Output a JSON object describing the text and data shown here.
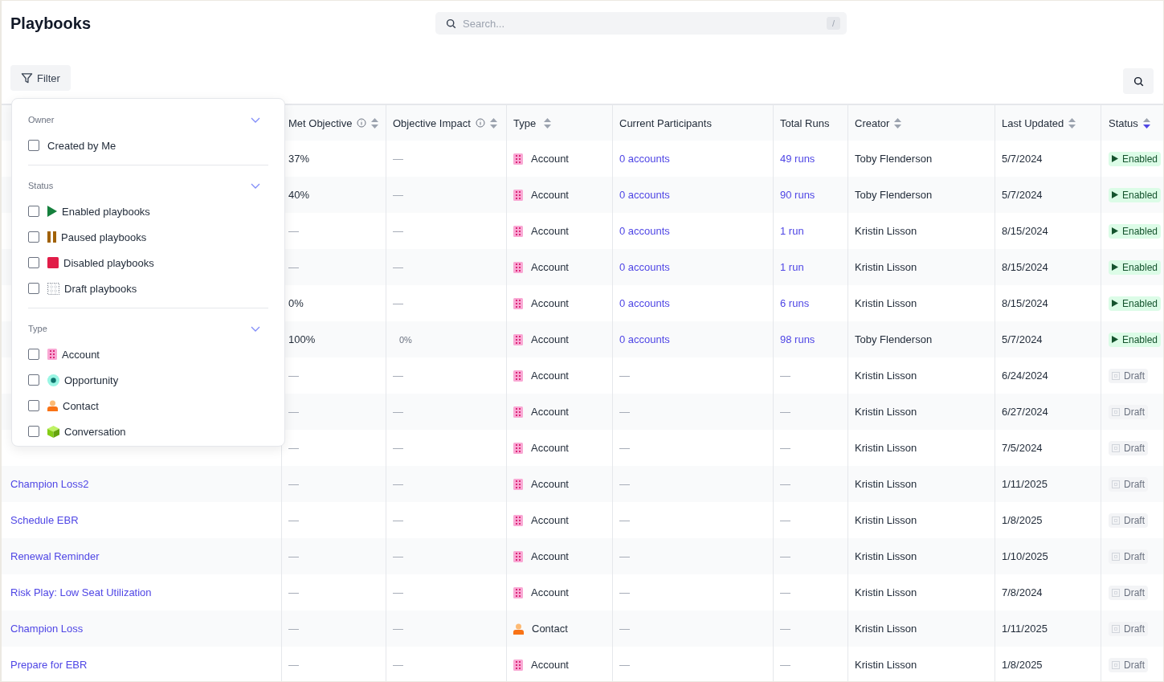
{
  "title": "Playbooks",
  "search": {
    "placeholder": "Search...",
    "shortcut": "/"
  },
  "filter_button": {
    "label": "Filter"
  },
  "table": {
    "columns": [
      {
        "label": "Met Objective",
        "info": true,
        "sortable": true,
        "sorted_desc": false
      },
      {
        "label": "Objective Impact",
        "info": true,
        "sortable": true,
        "sorted_desc": false
      },
      {
        "label": "Type",
        "info": false,
        "sortable": true,
        "sorted_desc": false
      },
      {
        "label": "Current Participants",
        "info": false,
        "sortable": false
      },
      {
        "label": "Total Runs",
        "info": false,
        "sortable": false
      },
      {
        "label": "Creator",
        "info": false,
        "sortable": true,
        "sorted_desc": false
      },
      {
        "label": "Last Updated",
        "info": false,
        "sortable": true,
        "sorted_desc": false
      },
      {
        "label": "Status",
        "info": false,
        "sortable": true,
        "sorted_desc": true
      }
    ],
    "rows": [
      {
        "met": "37%",
        "impact": "—",
        "type": {
          "kind": "account",
          "label": "Account"
        },
        "participants": "0 accounts",
        "runs": "49 runs",
        "creator": "Toby Flenderson",
        "updated": "5/7/2024",
        "status": {
          "kind": "enabled",
          "label": "Enabled"
        }
      },
      {
        "met": "40%",
        "impact": "—",
        "type": {
          "kind": "account",
          "label": "Account"
        },
        "participants": "0 accounts",
        "runs": "90 runs",
        "creator": "Toby Flenderson",
        "updated": "5/7/2024",
        "status": {
          "kind": "enabled",
          "label": "Enabled"
        }
      },
      {
        "met": "—",
        "impact": "—",
        "type": {
          "kind": "account",
          "label": "Account"
        },
        "participants": "0 accounts",
        "runs": "1 run",
        "creator": "Kristin Lisson",
        "updated": "8/15/2024",
        "status": {
          "kind": "enabled",
          "label": "Enabled"
        }
      },
      {
        "met": "—",
        "impact": "—",
        "type": {
          "kind": "account",
          "label": "Account"
        },
        "participants": "0 accounts",
        "runs": "1 run",
        "creator": "Kristin Lisson",
        "updated": "8/15/2024",
        "status": {
          "kind": "enabled",
          "label": "Enabled"
        }
      },
      {
        "met": "0%",
        "impact": "—",
        "type": {
          "kind": "account",
          "label": "Account"
        },
        "participants": "0 accounts",
        "runs": "6 runs",
        "creator": "Kristin Lisson",
        "updated": "8/15/2024",
        "status": {
          "kind": "enabled",
          "label": "Enabled"
        }
      },
      {
        "met": "100%",
        "impact": "0%",
        "type": {
          "kind": "account",
          "label": "Account"
        },
        "participants": "0 accounts",
        "runs": "98 runs",
        "creator": "Toby Flenderson",
        "updated": "5/7/2024",
        "status": {
          "kind": "enabled",
          "label": "Enabled"
        }
      },
      {
        "met": "—",
        "impact": "—",
        "type": {
          "kind": "account",
          "label": "Account"
        },
        "participants": "—",
        "runs": "—",
        "creator": "Kristin Lisson",
        "updated": "6/24/2024",
        "status": {
          "kind": "draft",
          "label": "Draft"
        }
      },
      {
        "met": "—",
        "impact": "—",
        "type": {
          "kind": "account",
          "label": "Account"
        },
        "participants": "—",
        "runs": "—",
        "creator": "Kristin Lisson",
        "updated": "6/27/2024",
        "status": {
          "kind": "draft",
          "label": "Draft"
        }
      },
      {
        "met": "—",
        "impact": "—",
        "type": {
          "kind": "account",
          "label": "Account"
        },
        "participants": "—",
        "runs": "—",
        "creator": "Kristin Lisson",
        "updated": "7/5/2024",
        "status": {
          "kind": "draft",
          "label": "Draft"
        }
      },
      {
        "name": "Champion Loss2",
        "met": "—",
        "impact": "—",
        "type": {
          "kind": "account",
          "label": "Account"
        },
        "participants": "—",
        "runs": "—",
        "creator": "Kristin Lisson",
        "updated": "1/11/2025",
        "status": {
          "kind": "draft",
          "label": "Draft"
        }
      },
      {
        "name": "Schedule EBR",
        "met": "—",
        "impact": "—",
        "type": {
          "kind": "account",
          "label": "Account"
        },
        "participants": "—",
        "runs": "—",
        "creator": "Kristin Lisson",
        "updated": "1/8/2025",
        "status": {
          "kind": "draft",
          "label": "Draft"
        }
      },
      {
        "name": "Renewal Reminder",
        "met": "—",
        "impact": "—",
        "type": {
          "kind": "account",
          "label": "Account"
        },
        "participants": "—",
        "runs": "—",
        "creator": "Kristin Lisson",
        "updated": "1/10/2025",
        "status": {
          "kind": "draft",
          "label": "Draft"
        }
      },
      {
        "name": "Risk Play: Low Seat Utilization",
        "met": "—",
        "impact": "—",
        "type": {
          "kind": "account",
          "label": "Account"
        },
        "participants": "—",
        "runs": "—",
        "creator": "Kristin Lisson",
        "updated": "7/8/2024",
        "status": {
          "kind": "draft",
          "label": "Draft"
        }
      },
      {
        "name": "Champion Loss",
        "met": "—",
        "impact": "—",
        "type": {
          "kind": "contact",
          "label": "Contact"
        },
        "participants": "—",
        "runs": "—",
        "creator": "Kristin Lisson",
        "updated": "1/11/2025",
        "status": {
          "kind": "draft",
          "label": "Draft"
        }
      },
      {
        "name": "Prepare for EBR",
        "met": "—",
        "impact": "—",
        "type": {
          "kind": "account",
          "label": "Account"
        },
        "participants": "—",
        "runs": "—",
        "creator": "Kristin Lisson",
        "updated": "1/8/2025",
        "status": {
          "kind": "draft",
          "label": "Draft"
        }
      }
    ]
  },
  "filter_popover": {
    "sections": [
      {
        "label": "Owner",
        "options": [
          {
            "label": "Created by Me",
            "kind": "plain",
            "checked": false
          }
        ]
      },
      {
        "label": "Status",
        "options": [
          {
            "label": "Enabled playbooks",
            "kind": "enabled",
            "checked": false
          },
          {
            "label": "Paused playbooks",
            "kind": "paused",
            "checked": false
          },
          {
            "label": "Disabled playbooks",
            "kind": "disabled",
            "checked": false
          },
          {
            "label": "Draft playbooks",
            "kind": "draft",
            "checked": false
          }
        ]
      },
      {
        "label": "Type",
        "options": [
          {
            "label": "Account",
            "kind": "account",
            "checked": false
          },
          {
            "label": "Opportunity",
            "kind": "opportunity",
            "checked": false
          },
          {
            "label": "Contact",
            "kind": "contact",
            "checked": false
          },
          {
            "label": "Conversation",
            "kind": "conversation",
            "checked": false
          }
        ]
      }
    ]
  }
}
